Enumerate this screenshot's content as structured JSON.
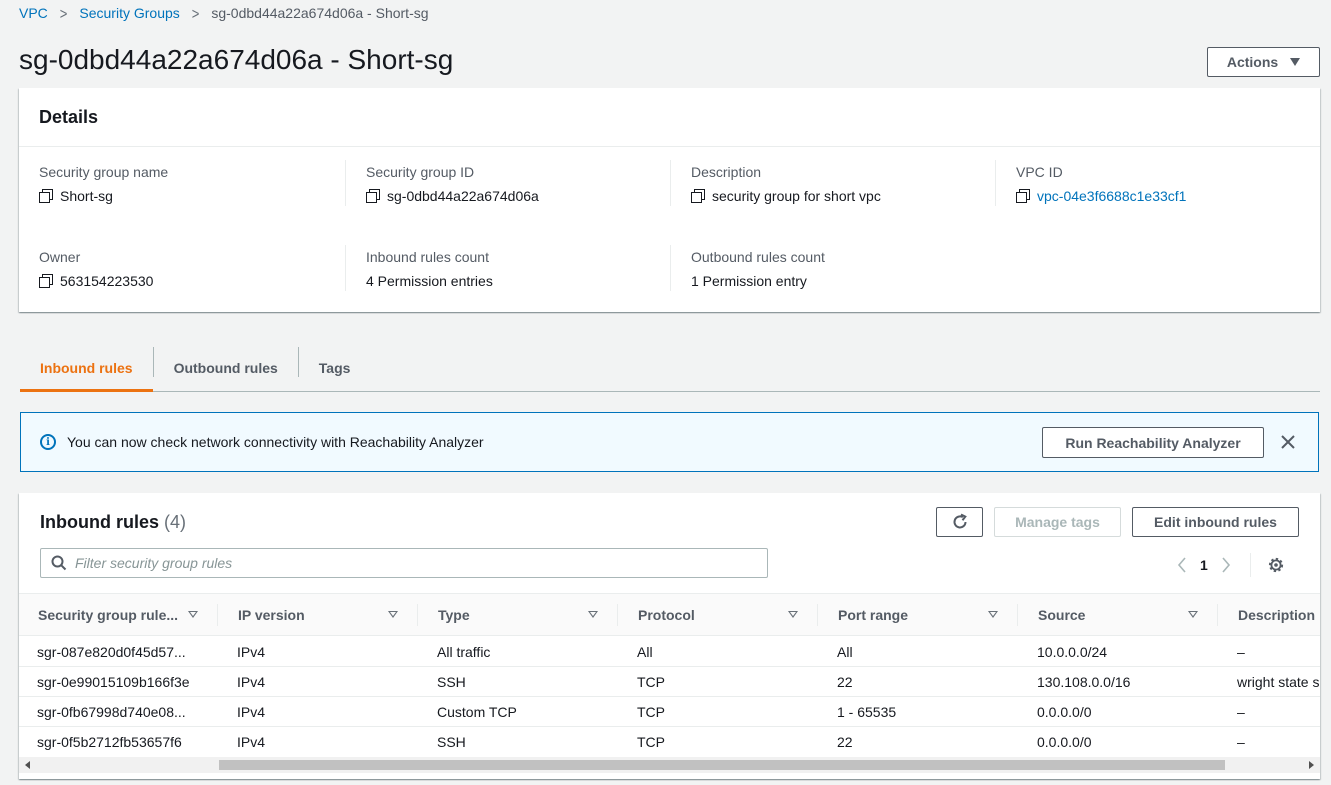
{
  "breadcrumb": {
    "items": [
      "VPC",
      "Security Groups"
    ],
    "current": "sg-0dbd44a22a674d06a - Short-sg"
  },
  "header": {
    "title": "sg-0dbd44a22a674d06a - Short-sg",
    "actions_label": "Actions"
  },
  "details": {
    "title": "Details",
    "fields": [
      {
        "label": "Security group name",
        "value": "Short-sg"
      },
      {
        "label": "Security group ID",
        "value": "sg-0dbd44a22a674d06a"
      },
      {
        "label": "Description",
        "value": "security group for short vpc"
      },
      {
        "label": "VPC ID",
        "value": "vpc-04e3f6688c1e33cf1"
      },
      {
        "label": "Owner",
        "value": "563154223530"
      },
      {
        "label": "Inbound rules count",
        "value": "4 Permission entries"
      },
      {
        "label": "Outbound rules count",
        "value": "1 Permission entry"
      }
    ]
  },
  "tabs": [
    {
      "label": "Inbound rules",
      "active": true
    },
    {
      "label": "Outbound rules",
      "active": false
    },
    {
      "label": "Tags",
      "active": false
    }
  ],
  "flash": {
    "message": "You can now check network connectivity with Reachability Analyzer",
    "button_label": "Run Reachability Analyzer"
  },
  "inbound": {
    "title": "Inbound rules",
    "count": "(4)",
    "manage_tags_label": "Manage tags",
    "edit_label": "Edit inbound rules",
    "search_placeholder": "Filter security group rules",
    "page": "1",
    "columns": [
      "Security group rule...",
      "IP version",
      "Type",
      "Protocol",
      "Port range",
      "Source",
      "Description"
    ],
    "rows": [
      [
        "sgr-087e820d0f45d57...",
        "IPv4",
        "All traffic",
        "All",
        "All",
        "10.0.0.0/24",
        "–"
      ],
      [
        "sgr-0e99015109b166f3e",
        "IPv4",
        "SSH",
        "TCP",
        "22",
        "130.108.0.0/16",
        "wright state sub"
      ],
      [
        "sgr-0fb67998d740e08...",
        "IPv4",
        "Custom TCP",
        "TCP",
        "1 - 65535",
        "0.0.0.0/0",
        "–"
      ],
      [
        "sgr-0f5b2712fb53657f6",
        "IPv4",
        "SSH",
        "TCP",
        "22",
        "0.0.0.0/0",
        "–"
      ]
    ]
  },
  "colors": {
    "link": "#0073bb",
    "active_tab": "#ec7211",
    "flash_border": "#0073bb",
    "flash_bg": "#f1faff"
  },
  "icons": [
    "chevron-right-icon",
    "caret-down-icon",
    "copy-icon",
    "info-icon",
    "close-icon",
    "refresh-icon",
    "search-icon",
    "chevron-left-icon",
    "gear-icon",
    "sort-icon"
  ]
}
